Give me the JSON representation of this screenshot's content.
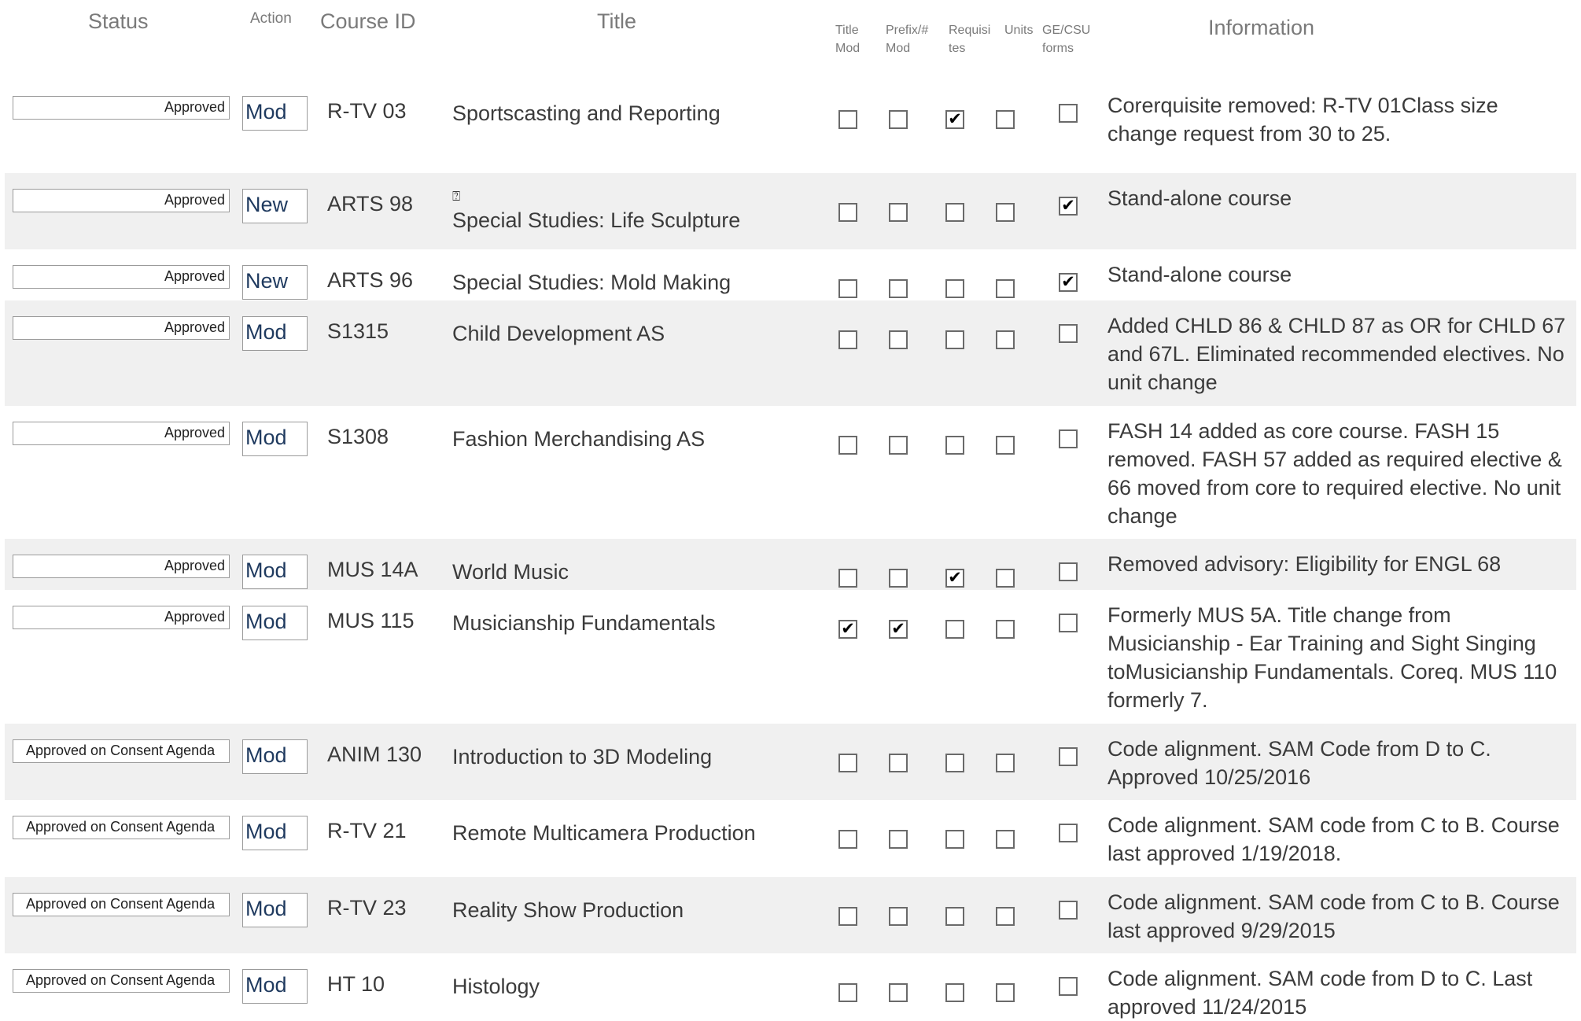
{
  "headers": {
    "status": "Status",
    "action": "Action",
    "course_id": "Course ID",
    "title": "Title",
    "title_mod": "Title Mod",
    "prefix_mod": "Prefix/# Mod",
    "requisites": "Requisi tes",
    "units": "Units",
    "ge_csu": "GE/CSU forms",
    "information": "Information"
  },
  "check_mark": "✔",
  "rows": [
    {
      "status": "Approved",
      "action": "Mod",
      "course_id": "R-TV 03",
      "title": "Sportscasting and Reporting",
      "title_glyph": "",
      "checks": [
        false,
        false,
        true,
        false,
        false
      ],
      "info": "Corerquisite removed: R-TV 01Class size change request from 30 to 25."
    },
    {
      "status": "Approved",
      "action": "New",
      "course_id": "ARTS 98",
      "title": "Special Studies: Life Sculpture",
      "title_glyph": "⍰",
      "checks": [
        false,
        false,
        false,
        false,
        true
      ],
      "info": "Stand-alone course"
    },
    {
      "status": "Approved",
      "action": "New",
      "course_id": "ARTS 96",
      "title": "Special Studies: Mold Making",
      "title_glyph": "",
      "checks": [
        false,
        false,
        false,
        false,
        true
      ],
      "info": "Stand-alone course"
    },
    {
      "status": "Approved",
      "action": "Mod",
      "course_id": "S1315",
      "title": "Child Development AS",
      "title_glyph": "",
      "checks": [
        false,
        false,
        false,
        false,
        false
      ],
      "info": "Added CHLD 86 & CHLD 87 as OR for CHLD 67 and 67L. Eliminated recommended electives. No unit change"
    },
    {
      "status": "Approved",
      "action": "Mod",
      "course_id": "S1308",
      "title": "Fashion Merchandising AS",
      "title_glyph": "",
      "checks": [
        false,
        false,
        false,
        false,
        false
      ],
      "info": "FASH 14  added as core course. FASH 15 removed. FASH 57 added as required elective & 66 moved from core to required elective. No unit change"
    },
    {
      "status": "Approved",
      "action": "Mod",
      "course_id": "MUS 14A",
      "title": "World Music",
      "title_glyph": "",
      "checks": [
        false,
        false,
        true,
        false,
        false
      ],
      "info": "Removed advisory: Eligibility for ENGL 68"
    },
    {
      "status": "Approved",
      "action": "Mod",
      "course_id": "MUS 115",
      "title": "Musicianship Fundamentals",
      "title_glyph": "",
      "checks": [
        true,
        true,
        false,
        false,
        false
      ],
      "info": "Formerly MUS 5A. Title change from Musicianship - Ear Training and Sight Singing toMusicianship Fundamentals. Coreq. MUS 110 formerly 7."
    },
    {
      "status": "Approved on Consent Agenda",
      "action": "Mod",
      "course_id": "ANIM 130",
      "title": "Introduction to 3D Modeling",
      "title_glyph": "",
      "checks": [
        false,
        false,
        false,
        false,
        false
      ],
      "info": " Code alignment. SAM Code from D to C. Approved 10/25/2016"
    },
    {
      "status": "Approved on Consent Agenda",
      "action": "Mod",
      "course_id": "R-TV 21",
      "title": "Remote Multicamera Production",
      "title_glyph": "",
      "checks": [
        false,
        false,
        false,
        false,
        false
      ],
      "info": "Code alignment. SAM code from C to B. Course last approved 1/19/2018."
    },
    {
      "status": "Approved on Consent Agenda",
      "action": "Mod",
      "course_id": "R-TV 23",
      "title": "Reality Show Production",
      "title_glyph": "",
      "checks": [
        false,
        false,
        false,
        false,
        false
      ],
      "info": "Code alignment. SAM code from C to B. Course last approved 9/29/2015"
    },
    {
      "status": "Approved on Consent Agenda",
      "action": "Mod",
      "course_id": "HT 10",
      "title": "Histology",
      "title_glyph": "",
      "checks": [
        false,
        false,
        false,
        false,
        false
      ],
      "info": "Code alignment. SAM code from D to C. Last approved 11/24/2015"
    }
  ]
}
